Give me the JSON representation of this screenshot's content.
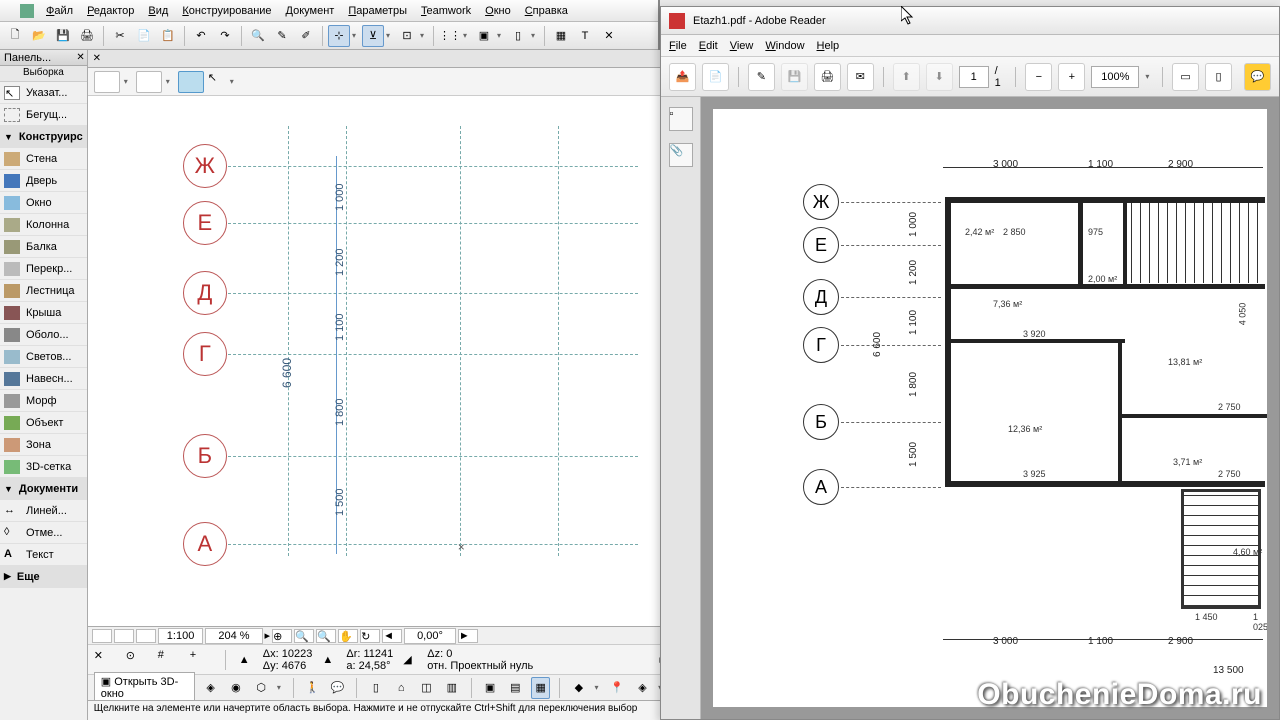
{
  "archicad": {
    "menu": [
      "Файл",
      "Редактор",
      "Вид",
      "Конструирование",
      "Документ",
      "Параметры",
      "Teamwork",
      "Окно",
      "Справка"
    ],
    "panel_title": "Панель...",
    "selection_title": "Выборка",
    "pointer": "Указат...",
    "marquee": "Бегущ...",
    "group_construct": "Конструирс",
    "tools": [
      "Стена",
      "Дверь",
      "Окно",
      "Колонна",
      "Балка",
      "Перекр...",
      "Лестница",
      "Крыша",
      "Оболо...",
      "Светов...",
      "Навесн...",
      "Морф",
      "Объект",
      "Зона",
      "3D-сетка"
    ],
    "group_doc": "Документи",
    "doc_tools": [
      "Линей...",
      "Отме...",
      "Текст"
    ],
    "more": "Еще",
    "grid_labels": [
      "Ж",
      "Е",
      "Д",
      "Г",
      "Б",
      "А"
    ],
    "dims": {
      "d1": "1 000",
      "d2": "1 200",
      "d3": "1 100",
      "d4": "1 800",
      "d5": "1 500",
      "d6": "6 600"
    },
    "bottom": {
      "scale": "1:100",
      "zoom": "204 %",
      "angle": "0,00°"
    },
    "coords": {
      "dx": "Δx:  10223",
      "dy": "Δy:  4676",
      "dr": "Δr:  11241",
      "da": "a:  24,58°",
      "dz": "Δz:  0",
      "ref": "отн. Проектный нуль"
    },
    "open3d": "Открыть 3D-окно",
    "status": "Щелкните на элементе или начертите область выбора. Нажмите и не отпускайте Ctrl+Shift для переключения выбор"
  },
  "reader": {
    "title": "Etazh1.pdf - Adobe Reader",
    "menu": [
      "File",
      "Edit",
      "View",
      "Window",
      "Help"
    ],
    "page_cur": "1",
    "page_total": "/ 1",
    "zoom": "100%",
    "grid_labels": [
      "Ж",
      "Е",
      "Д",
      "Г",
      "Б",
      "А"
    ],
    "hdims": {
      "d1": "3 000",
      "d2": "1 100",
      "d3": "2 900"
    },
    "vdims": {
      "d1": "1 000",
      "d2": "1 200",
      "d3": "1 100",
      "d4": "6 600",
      "d5": "1 800",
      "d6": "1 500"
    },
    "rooms": {
      "r1": "2,42 м²",
      "r1b": "2 850",
      "r2": "975",
      "r3": "2,00 м²",
      "r4": "7,36 м²",
      "r5": "3 920",
      "r6": "13,81 м²",
      "r6b": "4 050",
      "r7": "2 750",
      "r8": "12,36 м²",
      "r9": "3 925",
      "r10": "3,71 м²",
      "r10b": "2 750",
      "r11": "4,60 м²",
      "r12": "1 450",
      "r13": "1 025",
      "r14": "13 500"
    }
  },
  "watermark": "ObuchenieDoma.ru"
}
